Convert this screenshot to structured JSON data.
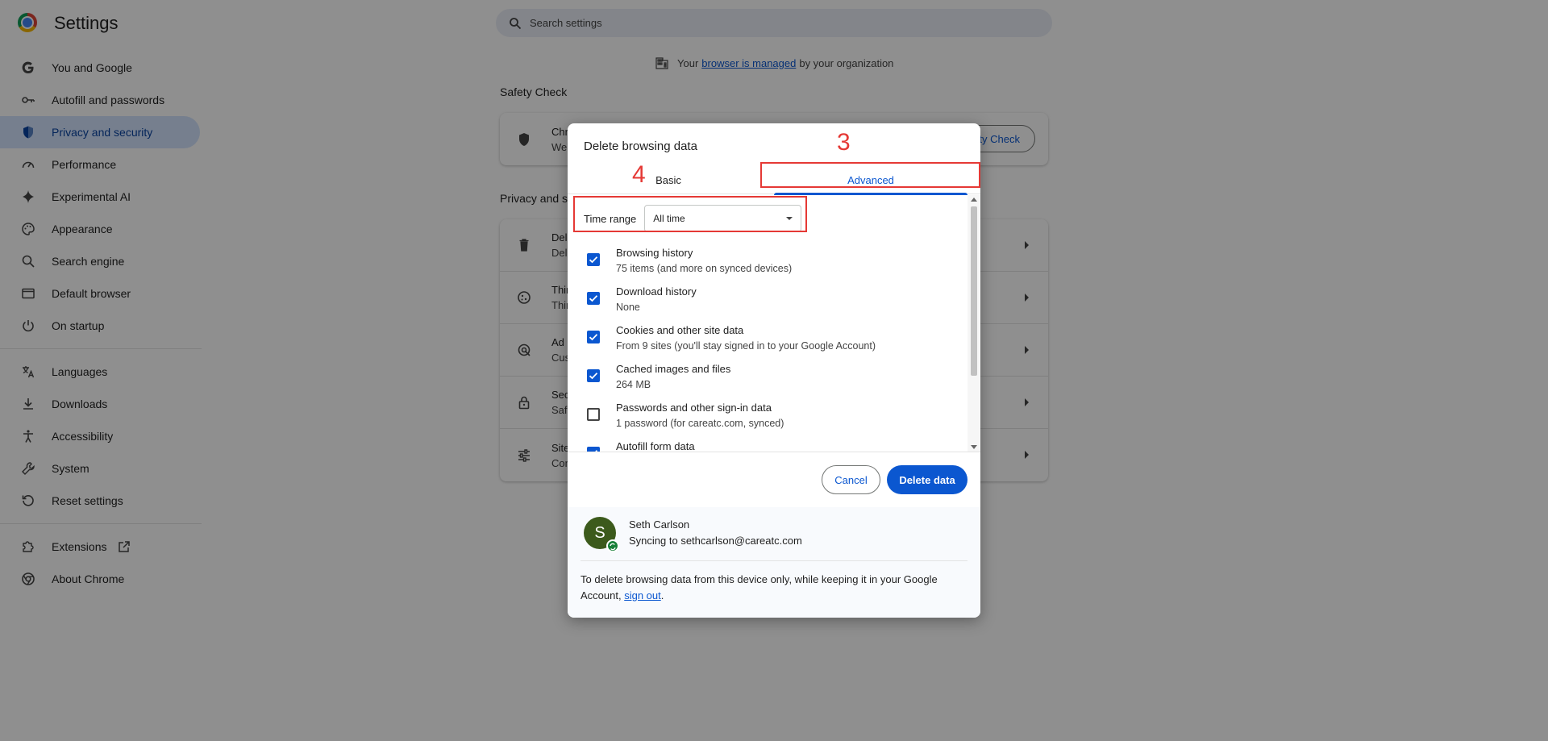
{
  "app": {
    "title": "Settings"
  },
  "search": {
    "placeholder": "Search settings"
  },
  "sidebar": {
    "items": [
      {
        "label": "You and Google",
        "icon": "google-g-icon"
      },
      {
        "label": "Autofill and passwords",
        "icon": "key-icon"
      },
      {
        "label": "Privacy and security",
        "icon": "shield-icon",
        "active": true
      },
      {
        "label": "Performance",
        "icon": "speedometer-icon"
      },
      {
        "label": "Experimental AI",
        "icon": "sparkle-icon"
      },
      {
        "label": "Appearance",
        "icon": "palette-icon"
      },
      {
        "label": "Search engine",
        "icon": "search-icon"
      },
      {
        "label": "Default browser",
        "icon": "browser-window-icon"
      },
      {
        "label": "On startup",
        "icon": "power-icon"
      },
      {
        "label": "Languages",
        "icon": "translate-icon"
      },
      {
        "label": "Downloads",
        "icon": "download-icon"
      },
      {
        "label": "Accessibility",
        "icon": "accessibility-icon"
      },
      {
        "label": "System",
        "icon": "wrench-icon"
      },
      {
        "label": "Reset settings",
        "icon": "reset-icon"
      },
      {
        "label": "Extensions",
        "icon": "puzzle-icon"
      },
      {
        "label": "About Chrome",
        "icon": "chrome-icon"
      }
    ]
  },
  "managed": {
    "prefix": "Your",
    "link": "browser is managed",
    "suffix": "by your organization"
  },
  "safety_check": {
    "heading": "Safety Check",
    "line1": "Chrom",
    "line2": "We'll",
    "button": "ty Check"
  },
  "privacy": {
    "heading": "Privacy and s",
    "rows": [
      {
        "t": "Dele",
        "s": "Dele"
      },
      {
        "t": "Third",
        "s": "Third"
      },
      {
        "t": "Ad p",
        "s": "Custo"
      },
      {
        "t": "Secu",
        "s": "Safe"
      },
      {
        "t": "Site s",
        "s": "Cont"
      }
    ]
  },
  "dialog": {
    "title": "Delete browsing data",
    "tabs": {
      "basic": "Basic",
      "advanced": "Advanced"
    },
    "time_range": {
      "label": "Time range",
      "value": "All time"
    },
    "options": [
      {
        "title": "Browsing history",
        "sub": "75 items (and more on synced devices)",
        "checked": true
      },
      {
        "title": "Download history",
        "sub": "None",
        "checked": true
      },
      {
        "title": "Cookies and other site data",
        "sub": "From 9 sites (you'll stay signed in to your Google Account)",
        "checked": true
      },
      {
        "title": "Cached images and files",
        "sub": "264 MB",
        "checked": true
      },
      {
        "title": "Passwords and other sign-in data",
        "sub": "1 password (for careatc.com, synced)",
        "checked": false
      },
      {
        "title": "Autofill form data",
        "sub": "",
        "checked": true
      }
    ],
    "cancel": "Cancel",
    "delete": "Delete data",
    "account": {
      "initial": "S",
      "name": "Seth Carlson",
      "sync": "Syncing to sethcarlson@careatc.com"
    },
    "note_before": "To delete browsing data from this device only, while keeping it in your Google Account,",
    "note_link": "sign out",
    "note_after": "."
  },
  "annotations": {
    "n3": "3",
    "n4": "4"
  },
  "colors": {
    "accent": "#0b57d0",
    "annotation": "#e53935",
    "active_nav": "#d3e3fd"
  }
}
